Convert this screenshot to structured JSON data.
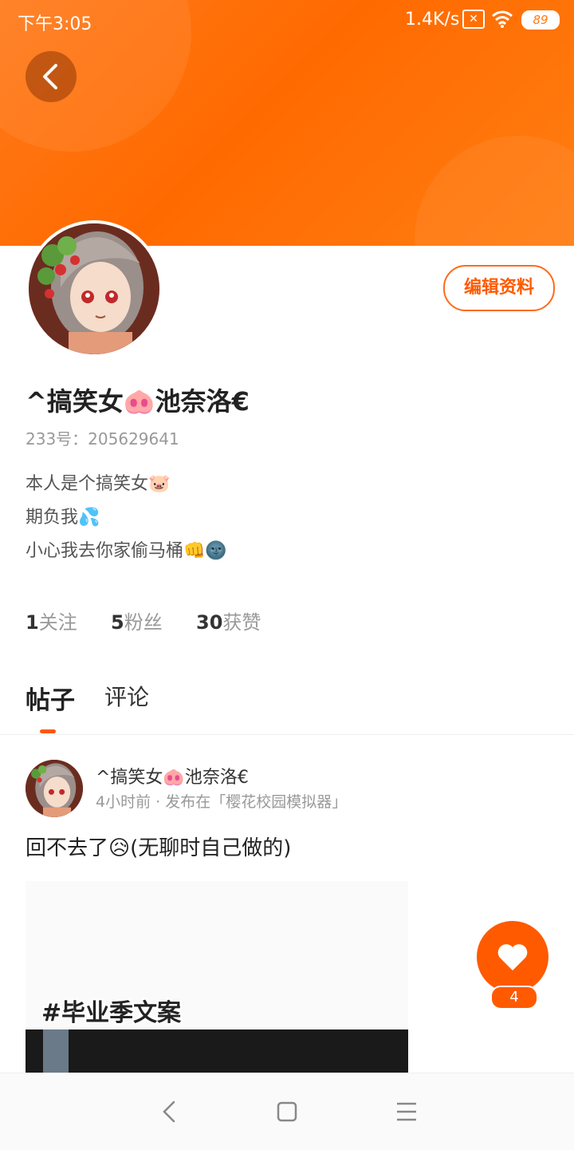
{
  "status": {
    "time": "下午3:05",
    "net_speed": "1.4K/s",
    "battery": "89"
  },
  "profile": {
    "username": "^搞笑女🐽池奈洛€",
    "uid": "233号：205629641",
    "bio": [
      "本人是个搞笑女🐷",
      "期负我💦",
      "小心我去你家偷马桶👊🌚"
    ],
    "edit_label": "编辑资料"
  },
  "stats": [
    {
      "count": "1",
      "label": "关注"
    },
    {
      "count": "5",
      "label": "粉丝"
    },
    {
      "count": "30",
      "label": "获赞"
    }
  ],
  "tabs": [
    {
      "label": "帖子",
      "active": true
    },
    {
      "label": "评论",
      "active": false
    }
  ],
  "post": {
    "author": "^搞笑女🐽池奈洛€",
    "meta": "4小时前 · 发布在「樱花校园模拟器」",
    "text": "回不去了😥(无聊时自己做的)",
    "image_tag": "#毕业季文案",
    "likes": "4"
  },
  "colors": {
    "accent": "#ff5a00",
    "banner": "#ff7a1a"
  },
  "icons": [
    "back-arrow-icon",
    "heart-icon",
    "wifi-icon",
    "sim-icon",
    "battery-icon",
    "nav-back-icon",
    "nav-home-icon",
    "nav-menu-icon"
  ]
}
